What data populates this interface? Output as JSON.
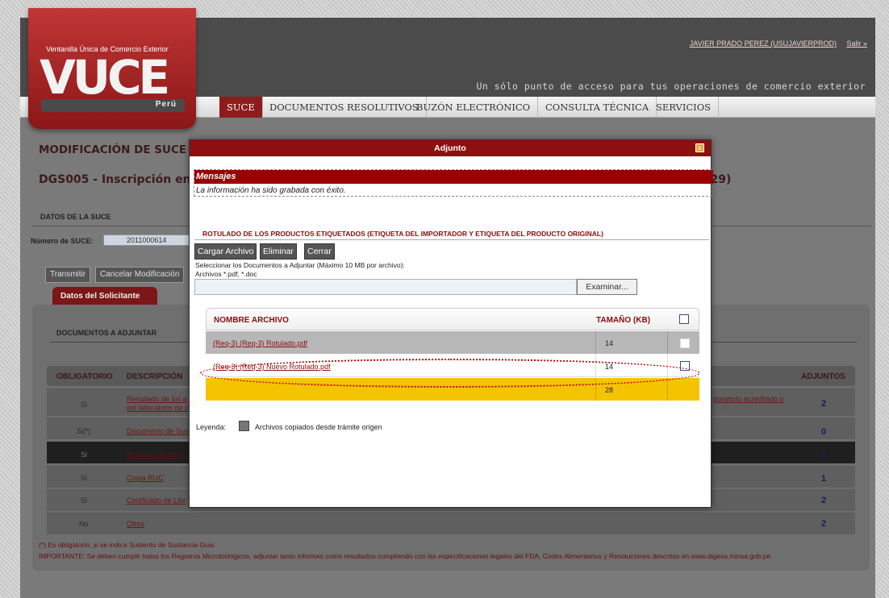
{
  "header": {
    "user_name": "JAVIER PRADO PEREZ (USUJAVIERPROD)",
    "logout": "Salir »",
    "tagline": "Un sólo punto de acceso para tus operaciones de comercio exterior",
    "logo_top": "Ventanilla Única de Comercio Exterior",
    "logo_word": "VUCE",
    "logo_country": "Perú"
  },
  "nav": {
    "items": [
      "SUCE",
      "DOCUMENTOS RESOLUTIVOS",
      "BUZÓN ELECTRÓNICO",
      "CONSULTA TÉCNICA",
      "SERVICIOS"
    ]
  },
  "page": {
    "title": "MODIFICACIÓN DE SUCE",
    "subtitle": "DGS005 - Inscripción en",
    "subtitle_right": ": 29)",
    "section_datos": "DATOS DE LA SUCE",
    "num_suce_label": "Número de SUCE:",
    "num_suce_value": "2011000614",
    "btn_transmitir": "Transmitir",
    "btn_cancelar": "Cancelar Modificación",
    "tab_solicitante": "Datos del Solicitante",
    "docs_title": "DOCUMENTOS A ADJUNTAR"
  },
  "doc_table": {
    "headers": {
      "obligatorio": "OBLIGATORIO",
      "descripcion": "DESCRIPCIÓN",
      "adjuntos": "ADJUNTOS"
    },
    "rows": [
      {
        "obligatorio": "Si",
        "descripcion": "Resultado de los a",
        "descripcion2": "del laboratorio de c",
        "extra": "poratorio acreditado o",
        "adjuntos": "2"
      },
      {
        "obligatorio": "Si(*)",
        "descripcion": "Documento de Sus",
        "descripcion2": "",
        "extra": "",
        "adjuntos": "0"
      },
      {
        "obligatorio": "Si",
        "descripcion": "Rotulado de los pr",
        "descripcion2": "",
        "extra": "",
        "adjuntos": "1"
      },
      {
        "obligatorio": "Si",
        "descripcion": "Copia RUC",
        "descripcion2": "",
        "extra": "",
        "adjuntos": "1"
      },
      {
        "obligatorio": "Si",
        "descripcion": "Certificado de Libr",
        "descripcion2": "",
        "extra": "",
        "adjuntos": "2"
      },
      {
        "obligatorio": "No",
        "descripcion": "Otros",
        "descripcion2": "",
        "extra": "",
        "adjuntos": "2"
      }
    ]
  },
  "footer": {
    "note1": "(*) Es obligatorio, si se indica Sustento de Sustancia Gras",
    "note2": "IMPORTANTE: Se deben cumplir todos los Registros Microbiológicos, adjuntar tanto informes como resultados cumpliendo con las especificaciones legales del FDA, Codex Alimentarius y Resoluciones descritos en www.digesa.minsa.gob.pe"
  },
  "modal": {
    "title": "Adjunto",
    "close": "x",
    "msg_head": "Mensajes",
    "msg_text": "La información ha sido grabada con éxito.",
    "section_title": "ROTULADO DE LOS PRODUCTOS ETIQUETADOS (ETIQUETA DEL IMPORTADOR Y ETIQUETA DEL PRODUCTO ORIGINAL)",
    "btn_cargar": "Cargar Archivo",
    "btn_eliminar": "Eliminar",
    "btn_cerrar": "Cerrar",
    "select_text": "Seleccionar los Documentos a Adjuntar (Máximo 10 MB por archivo):",
    "ext_text": "Archivos *.pdf, *.doc",
    "btn_examinar": "Examinar...",
    "col_name": "NOMBRE ARCHIVO",
    "col_size": "TAMAÑO (KB)",
    "files": [
      {
        "name": "(Req-3) (Req-3) Rotulado.pdf",
        "size": "14"
      },
      {
        "name": "(Req-3) (Req-3) Nuevo Rotulado.pdf",
        "size": "14"
      }
    ],
    "total": "28",
    "leyenda_label": "Leyenda:",
    "leyenda_text": "Archivos copiados desde trámite origen"
  }
}
